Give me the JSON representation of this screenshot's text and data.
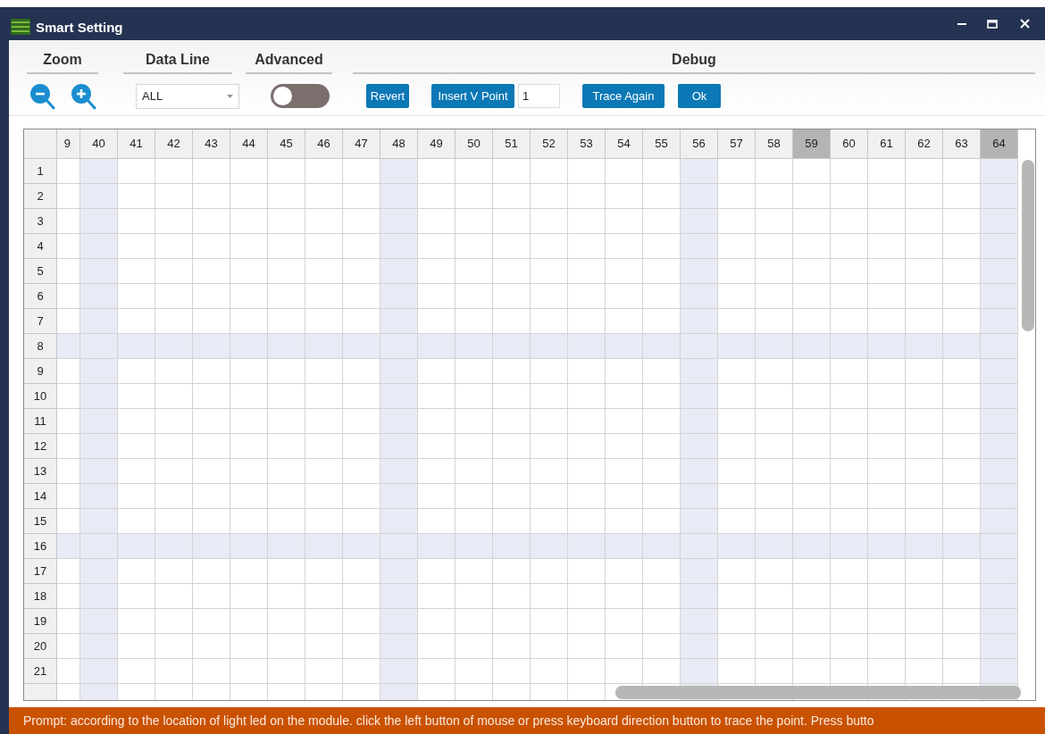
{
  "window": {
    "title": "Smart Setting"
  },
  "toolbar": {
    "sections": [
      {
        "kind": "zoom",
        "label": "Zoom"
      },
      {
        "kind": "dataline",
        "label": "Data Line"
      },
      {
        "kind": "advanced",
        "label": "Advanced"
      },
      {
        "kind": "debug",
        "label": "Debug"
      }
    ],
    "data_line": {
      "value": "ALL"
    },
    "advanced": {
      "on": false
    },
    "buttons": [
      {
        "kind": "button",
        "label": "Revert"
      },
      {
        "kind": "button",
        "label": "Insert V Point"
      },
      {
        "kind": "input",
        "value": "1"
      },
      {
        "kind": "button",
        "label": "Trace Again"
      },
      {
        "kind": "button",
        "label": "Ok"
      }
    ]
  },
  "grid": {
    "columns": [
      {
        "label": "9",
        "highlighted": false,
        "selected": false
      },
      {
        "label": "40",
        "highlighted": true,
        "selected": false
      },
      {
        "label": "41",
        "highlighted": false,
        "selected": false
      },
      {
        "label": "42",
        "highlighted": false,
        "selected": false
      },
      {
        "label": "43",
        "highlighted": false,
        "selected": false
      },
      {
        "label": "44",
        "highlighted": false,
        "selected": false
      },
      {
        "label": "45",
        "highlighted": false,
        "selected": false
      },
      {
        "label": "46",
        "highlighted": false,
        "selected": false
      },
      {
        "label": "47",
        "highlighted": false,
        "selected": false
      },
      {
        "label": "48",
        "highlighted": true,
        "selected": false
      },
      {
        "label": "49",
        "highlighted": false,
        "selected": false
      },
      {
        "label": "50",
        "highlighted": false,
        "selected": false
      },
      {
        "label": "51",
        "highlighted": false,
        "selected": false
      },
      {
        "label": "52",
        "highlighted": false,
        "selected": false
      },
      {
        "label": "53",
        "highlighted": false,
        "selected": false
      },
      {
        "label": "54",
        "highlighted": false,
        "selected": false
      },
      {
        "label": "55",
        "highlighted": false,
        "selected": false
      },
      {
        "label": "56",
        "highlighted": true,
        "selected": false
      },
      {
        "label": "57",
        "highlighted": false,
        "selected": false
      },
      {
        "label": "58",
        "highlighted": false,
        "selected": false
      },
      {
        "label": "59",
        "highlighted": false,
        "selected": true
      },
      {
        "label": "60",
        "highlighted": false,
        "selected": false
      },
      {
        "label": "61",
        "highlighted": false,
        "selected": false
      },
      {
        "label": "62",
        "highlighted": false,
        "selected": false
      },
      {
        "label": "63",
        "highlighted": false,
        "selected": false
      },
      {
        "label": "64",
        "highlighted": true,
        "selected": true
      }
    ],
    "rows": [
      {
        "label": "1",
        "highlighted": false
      },
      {
        "label": "2",
        "highlighted": false
      },
      {
        "label": "3",
        "highlighted": false
      },
      {
        "label": "4",
        "highlighted": false
      },
      {
        "label": "5",
        "highlighted": false
      },
      {
        "label": "6",
        "highlighted": false
      },
      {
        "label": "7",
        "highlighted": false
      },
      {
        "label": "8",
        "highlighted": true
      },
      {
        "label": "9",
        "highlighted": false
      },
      {
        "label": "10",
        "highlighted": false
      },
      {
        "label": "11",
        "highlighted": false
      },
      {
        "label": "12",
        "highlighted": false
      },
      {
        "label": "13",
        "highlighted": false
      },
      {
        "label": "14",
        "highlighted": false
      },
      {
        "label": "15",
        "highlighted": false
      },
      {
        "label": "16",
        "highlighted": true
      },
      {
        "label": "17",
        "highlighted": false
      },
      {
        "label": "18",
        "highlighted": false
      },
      {
        "label": "19",
        "highlighted": false
      },
      {
        "label": "20",
        "highlighted": false
      },
      {
        "label": "21",
        "highlighted": false
      }
    ]
  },
  "status_bar": {
    "text": "Prompt: according to the location of light led on the module. click the left button of mouse or press keyboard direction button to trace the point. Press butto"
  }
}
